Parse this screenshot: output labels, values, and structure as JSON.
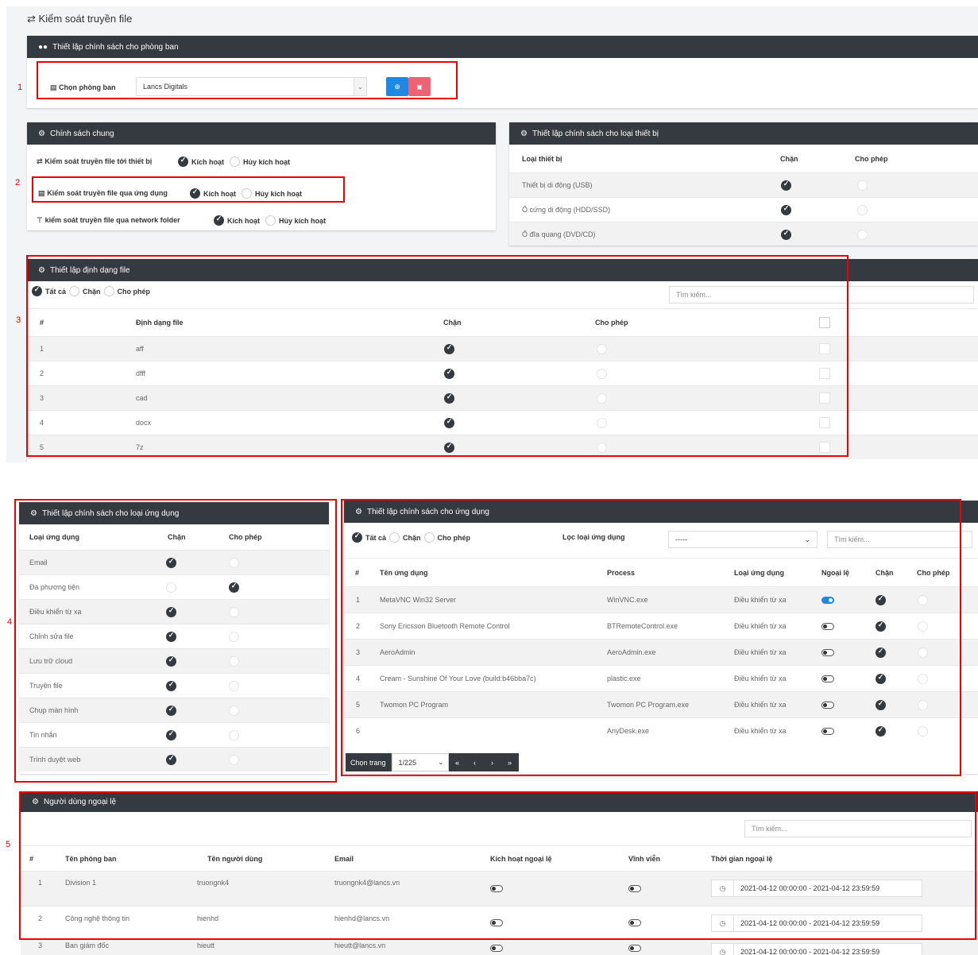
{
  "page": {
    "title": "Kiểm soát truyền file",
    "title_icon": "exchange-icon"
  },
  "annotations": [
    "1",
    "2",
    "3",
    "4",
    "5"
  ],
  "dept_policy": {
    "header": "Thiết lập chính sách cho phòng ban",
    "select_label": "Chọn phòng ban",
    "selected": "Lancs Digitals"
  },
  "general_policy": {
    "header": "Chính sách chung",
    "items": [
      {
        "label": "Kiểm soát truyền file tới thiết bị",
        "on": "Kích hoạt",
        "off": "Hủy kích hoạt",
        "active": true
      },
      {
        "label": "Kiểm soát truyền file qua ứng dụng",
        "on": "Kích hoạt",
        "off": "Hủy kích hoạt",
        "active": true
      },
      {
        "label": "kiểm soát truyền file qua network folder",
        "on": "Kích hoạt",
        "off": "Hủy kích hoạt",
        "active": true
      }
    ]
  },
  "device_policy": {
    "header": "Thiết lập chính sách cho loại thiết bị",
    "columns": [
      "Loại thiết bị",
      "Chặn",
      "Cho phép"
    ],
    "rows": [
      {
        "name": "Thiết bị di động (USB)",
        "block": true
      },
      {
        "name": "Ổ cứng di động (HDD/SSD)",
        "block": true
      },
      {
        "name": "Ổ đĩa quang (DVD/CD)",
        "block": true
      }
    ]
  },
  "file_format": {
    "header": "Thiết lập định dạng file",
    "filters": [
      "Tất cả",
      "Chặn",
      "Cho phép"
    ],
    "search_placeholder": "Tìm kiếm...",
    "columns": [
      "#",
      "Định dạng file",
      "Chặn",
      "Cho phép"
    ],
    "rows": [
      {
        "n": "1",
        "ext": "aff"
      },
      {
        "n": "2",
        "ext": "dfff"
      },
      {
        "n": "3",
        "ext": "cad"
      },
      {
        "n": "4",
        "ext": "docx"
      },
      {
        "n": "5",
        "ext": "7z"
      }
    ]
  },
  "app_type_policy": {
    "header": "Thiết lập chính sách cho loại ứng dụng",
    "columns": [
      "Loại ứng dụng",
      "Chặn",
      "Cho phép"
    ],
    "rows": [
      {
        "name": "Email",
        "block": true
      },
      {
        "name": "Đa phương tiện",
        "block": false
      },
      {
        "name": "Điều khiển từ xa",
        "block": true
      },
      {
        "name": "Chỉnh sửa file",
        "block": true
      },
      {
        "name": "Lưu trữ cloud",
        "block": true
      },
      {
        "name": "Truyền file",
        "block": true
      },
      {
        "name": "Chụp màn hình",
        "block": true
      },
      {
        "name": "Tin nhắn",
        "block": true
      },
      {
        "name": "Trình duyệt web",
        "block": true
      }
    ]
  },
  "app_policy": {
    "header": "Thiết lập chính sách cho ứng dụng",
    "filters": [
      "Tất cả",
      "Chặn",
      "Cho phép"
    ],
    "filter_type_label": "Lọc loại ứng dụng",
    "filter_type_value": "-----",
    "search_placeholder": "Tìm kiếm...",
    "columns": [
      "#",
      "Tên ứng dụng",
      "Process",
      "Loại ứng dụng",
      "Ngoại lệ",
      "Chặn",
      "Cho phép"
    ],
    "rows": [
      {
        "n": "1",
        "name": "MetaVNC Win32 Server",
        "process": "WinVNC.exe",
        "type": "Điều khiển từ xa",
        "exception": true
      },
      {
        "n": "2",
        "name": "Sony Ericsson Bluetooth Remote Control",
        "process": "BTRemoteControl.exe",
        "type": "Điều khiển từ xa",
        "exception": false
      },
      {
        "n": "3",
        "name": "AeroAdmin",
        "process": "AeroAdmin.exe",
        "type": "Điều khiển từ xa",
        "exception": false
      },
      {
        "n": "4",
        "name": "Cream - Sunshine Of Your Love (build:b46bba7c)",
        "process": "plastic.exe",
        "type": "Điều khiển từ xa",
        "exception": false
      },
      {
        "n": "5",
        "name": "Twomon PC Program",
        "process": "Twomon PC Program.exe",
        "type": "Điều khiển từ xa",
        "exception": false
      },
      {
        "n": "6",
        "name": "",
        "process": "AnyDesk.exe",
        "type": "Điều khiển từ xa",
        "exception": false
      }
    ],
    "pager": {
      "label": "Chọn trang",
      "page": "1/225"
    }
  },
  "exception_users": {
    "header": "Người dùng ngoại lệ",
    "search_placeholder": "Tìm kiếm...",
    "columns": [
      "#",
      "Tên phòng ban",
      "Tên người dùng",
      "Email",
      "Kích hoạt ngoại lệ",
      "Vĩnh viễn",
      "Thời gian ngoại lệ"
    ],
    "rows": [
      {
        "n": "1",
        "dept": "Division 1",
        "user": "truongnk4",
        "email": "truongnk4@lancs.vn",
        "time": "2021-04-12 00:00:00 - 2021-04-12 23:59:59"
      },
      {
        "n": "2",
        "dept": "Công nghệ thông tin",
        "user": "hienhd",
        "email": "hienhd@lancs.vn",
        "time": "2021-04-12 00:00:00 - 2021-04-12 23:59:59"
      },
      {
        "n": "3",
        "dept": "Ban giám đốc",
        "user": "hieutt",
        "email": "hieutt@lancs.vn",
        "time": "2021-04-12 00:00:00 - 2021-04-12 23:59:59"
      }
    ]
  },
  "colors": {
    "header_bg": "#343a40",
    "annotation_red": "#e00000",
    "add_button": "#1e88e5",
    "delete_button": "#f06272",
    "toggle_on": "#1e88e5"
  }
}
